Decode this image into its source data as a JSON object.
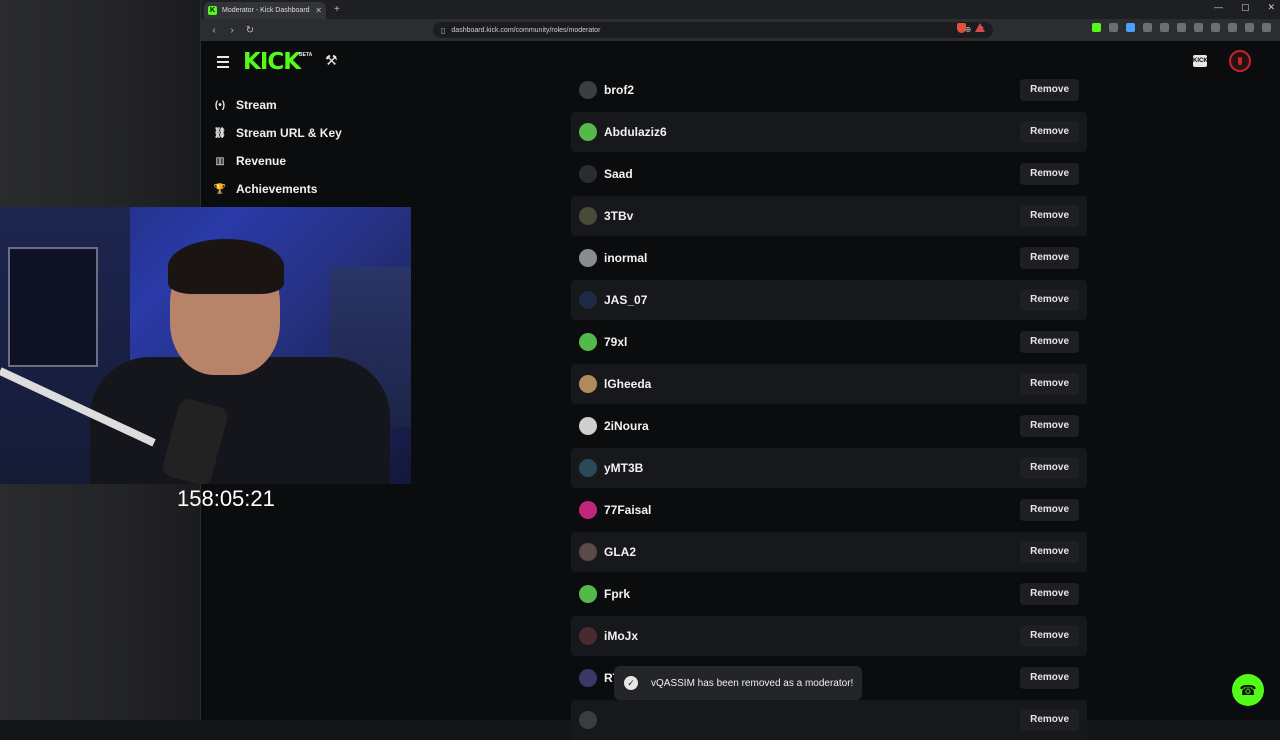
{
  "browser": {
    "tab_title": "Moderator - Kick Dashboard",
    "url": "dashboard.kick.com/community/roles/moderator"
  },
  "header": {
    "logo": "KICK",
    "beta_badge": "BETA",
    "kick_icon_label": "KICK"
  },
  "sidebar": {
    "items": [
      {
        "label": "Stream",
        "icon": "(•)"
      },
      {
        "label": "Stream URL & Key",
        "icon": "⛓"
      },
      {
        "label": "Revenue",
        "icon": "▥"
      },
      {
        "label": "Achievements",
        "icon": "🏆"
      }
    ]
  },
  "stream_overlay": {
    "timer": "158:05:21"
  },
  "moderators": {
    "remove_label": "Remove",
    "rows": [
      {
        "name": "brof2",
        "avatar_color": "#3a3d42"
      },
      {
        "name": "Abdulaziz6",
        "avatar_color": "#53b94a"
      },
      {
        "name": "Saad",
        "avatar_color": "#2a2c2f"
      },
      {
        "name": "3TBv",
        "avatar_color": "#4a4a3a"
      },
      {
        "name": "inormal",
        "avatar_color": "#8a8c90"
      },
      {
        "name": "JAS_07",
        "avatar_color": "#1e2a44"
      },
      {
        "name": "79xl",
        "avatar_color": "#53b94a"
      },
      {
        "name": "lGheeda",
        "avatar_color": "#b08a5a"
      },
      {
        "name": "2iNoura",
        "avatar_color": "#cfcfcf"
      },
      {
        "name": "yMT3B",
        "avatar_color": "#2a4a5a"
      },
      {
        "name": "77Faisal",
        "avatar_color": "#c0267a"
      },
      {
        "name": "GLA2",
        "avatar_color": "#5a4a48"
      },
      {
        "name": "Fprk",
        "avatar_color": "#53b94a"
      },
      {
        "name": "iMoJx",
        "avatar_color": "#4a2a2e"
      },
      {
        "name": "RT",
        "avatar_color": "#3a3a6a"
      },
      {
        "name": "",
        "avatar_color": "#3a3d42"
      }
    ]
  },
  "toast": {
    "message": "vQASSIM has been removed as a moderator!",
    "icon": "✓"
  },
  "help": {
    "icon": "☎"
  }
}
